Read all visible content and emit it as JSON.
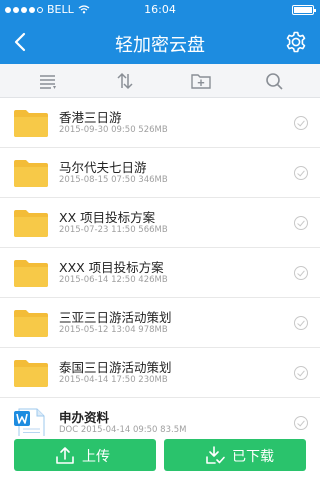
{
  "status": {
    "carrier": "BELL",
    "time": "16:04"
  },
  "header": {
    "title": "轻加密云盘"
  },
  "toolbar": {
    "icons": [
      "list-icon",
      "sort-icon",
      "new-folder-icon",
      "search-icon"
    ]
  },
  "files": [
    {
      "name": "香港三日游",
      "meta": "2015-09-30 09:50  526MB",
      "type": "folder"
    },
    {
      "name": "马尔代夫七日游",
      "meta": "2015-08-15 07:50  346MB",
      "type": "folder"
    },
    {
      "name": "XX 项目投标方案",
      "meta": "2015-07-23 11:50  566MB",
      "type": "folder"
    },
    {
      "name": "XXX 项目投标方案",
      "meta": "2015-06-14 12:50  426MB",
      "type": "folder"
    },
    {
      "name": "三亚三日游活动策划",
      "meta": "2015-05-12 13:04  978MB",
      "type": "folder"
    },
    {
      "name": "泰国三日游活动策划",
      "meta": "2015-04-14 17:50  230MB",
      "type": "folder"
    },
    {
      "name": "申办资料",
      "meta": "DOC  2015-04-14 09:50  83.5M",
      "type": "doc"
    }
  ],
  "actions": {
    "upload_label": "上传",
    "downloaded_label": "已下载"
  },
  "colors": {
    "header": "#1d8ce0",
    "folder": "#f7c948",
    "action": "#2ac36c"
  }
}
